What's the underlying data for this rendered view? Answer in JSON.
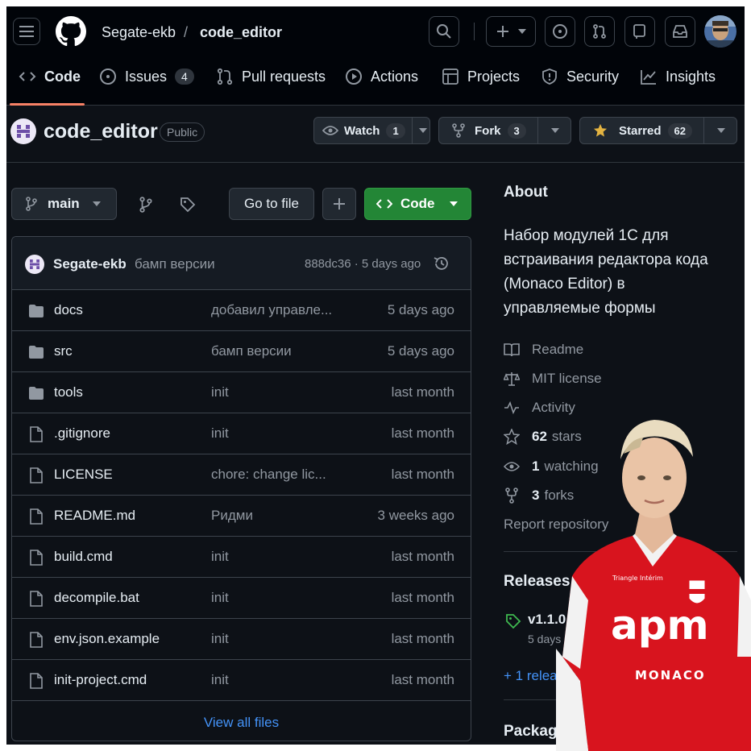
{
  "header": {
    "owner": "Segate-ekb",
    "separator": "/",
    "repo": "code_editor"
  },
  "nav": {
    "tabs": [
      {
        "label": "Code",
        "icon": "code-icon"
      },
      {
        "label": "Issues",
        "icon": "issue-opened-icon",
        "count": "4"
      },
      {
        "label": "Pull requests",
        "icon": "git-pull-request-icon"
      },
      {
        "label": "Actions",
        "icon": "play-icon"
      },
      {
        "label": "Projects",
        "icon": "table-icon"
      },
      {
        "label": "Security",
        "icon": "shield-icon"
      },
      {
        "label": "Insights",
        "icon": "graph-icon"
      }
    ]
  },
  "repo": {
    "name": "code_editor",
    "visibility": "Public",
    "watch_label": "Watch",
    "watch_count": "1",
    "fork_label": "Fork",
    "fork_count": "3",
    "star_label": "Starred",
    "star_count": "62"
  },
  "toolbar": {
    "branch": "main",
    "goto_file": "Go to file",
    "add": "+",
    "code_button": "Code"
  },
  "commit": {
    "author": "Segate-ekb",
    "message": "бамп версии",
    "hash_time": "888dc36 · 5 days ago"
  },
  "files": [
    {
      "type": "folder",
      "name": "docs",
      "message": "добавил управле...",
      "date": "5 days ago"
    },
    {
      "type": "folder",
      "name": "src",
      "message": "бамп версии",
      "date": "5 days ago"
    },
    {
      "type": "folder",
      "name": "tools",
      "message": "init",
      "date": "last month"
    },
    {
      "type": "file",
      "name": ".gitignore",
      "message": "init",
      "date": "last month"
    },
    {
      "type": "file",
      "name": "LICENSE",
      "message": "chore: change lic...",
      "date": "last month"
    },
    {
      "type": "file",
      "name": "README.md",
      "message": "Ридми",
      "date": "3 weeks ago"
    },
    {
      "type": "file",
      "name": "build.cmd",
      "message": "init",
      "date": "last month"
    },
    {
      "type": "file",
      "name": "decompile.bat",
      "message": "init",
      "date": "last month"
    },
    {
      "type": "file",
      "name": "env.json.example",
      "message": "init",
      "date": "last month"
    },
    {
      "type": "file",
      "name": "init-project.cmd",
      "message": "init",
      "date": "last month"
    }
  ],
  "view_all": "View all files",
  "about": {
    "title": "About",
    "description_lines": [
      "Набор модулей 1С для",
      "встраивания редактора кода",
      "(Monaco Editor) в",
      "управляемые формы"
    ],
    "readme": "Readme",
    "license": "MIT license",
    "activity": "Activity",
    "stars_num": "62",
    "stars_label": "stars",
    "watching_num": "1",
    "watching_label": "watching",
    "forks_num": "3",
    "forks_label": "forks",
    "report": "Report repository"
  },
  "releases": {
    "title": "Releases",
    "tag": "v1.1.0",
    "date": "5 days ago",
    "more": "+ 1 releases"
  },
  "packages": {
    "title": "Packages"
  },
  "player": {
    "shirt_text": "apm",
    "shirt_sub": "MONACO",
    "sponsor": "Triangle Intérim"
  }
}
